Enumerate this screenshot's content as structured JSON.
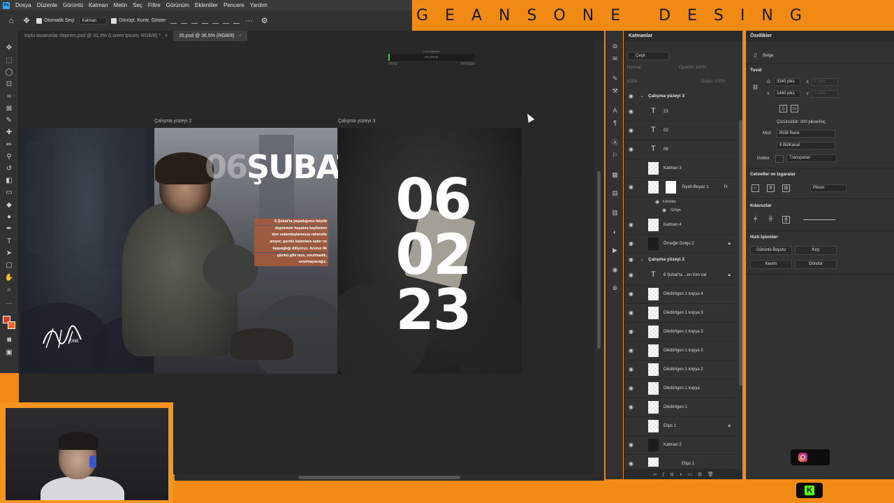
{
  "brand": {
    "text": "GEANSONE DESING"
  },
  "menu": [
    "Dosya",
    "Düzenle",
    "Görüntü",
    "Katman",
    "Metin",
    "Seç",
    "Filtre",
    "Görünüm",
    "Eklentiler",
    "Pencere",
    "Yardım"
  ],
  "options": {
    "auto_select": "Otomatik Seçi",
    "target": "Katman",
    "transform_controls": "Dönüşt. Kontr. Göster"
  },
  "tabs": [
    {
      "label": "toplu tasarımlar deprem.psd @ 31,3% (Lorem Ipsum, RGB/8) *",
      "active": false
    },
    {
      "label": "26.psd @ 36,6% (RGB/8)",
      "active": true
    }
  ],
  "widget": {
    "caption": "Yürü Bitkokun",
    "value_text": "%0 (TRY0)",
    "low": "TRY0",
    "high": "TRY5000",
    "progress": 0.0
  },
  "artboards": {
    "label_2": "Çalışma yüzeyi 2",
    "label_3": "Çalışma yüzeyi 3"
  },
  "poster": {
    "headline_ghost": "06",
    "headline": "ŞUBAT",
    "caption_lines": [
      "6 Şubat'ta yaşadığımız büyük",
      "depremde hayatını kaybeden",
      "tüm vatandaşlarımıza rahmetle",
      "anıyor, geride kalanlara sabır ve",
      "başsağlığı diliyoruz. Acımız ilk",
      "günkü gibi taze, unutmadık,",
      "unutmayacağız."
    ],
    "date_day": "06",
    "date_month": "02",
    "date_year": "23"
  },
  "layers": {
    "title": "Katmanlar",
    "filter": "Çeşit",
    "blend": "Normal",
    "opacity_label": "Opaklık: 100%",
    "lock_label": "Kilitle:",
    "fill_label": "Dolgu: 100%",
    "groups": [
      {
        "name": "Çalışma yüzeyi 3"
      },
      {
        "name": "Çalışma yüzeyi 2"
      }
    ],
    "rows": [
      {
        "name": "23",
        "kind": "text"
      },
      {
        "name": "02",
        "kind": "text"
      },
      {
        "name": "06",
        "kind": "text"
      },
      {
        "name": "Katman 3",
        "kind": "image"
      },
      {
        "name": "Siyah-Beyaz 1",
        "kind": "adjust",
        "fx": "fx"
      },
      {
        "name": "Katman 4",
        "kind": "image"
      },
      {
        "name": "Örneğin Dolgu 2",
        "kind": "dark",
        "locked": true
      },
      {
        "name": "6 Şubat'ta ...en tüm vat",
        "kind": "text",
        "locked": true
      },
      {
        "name": "Dikdörtgen 1 kopya 4",
        "kind": "shape"
      },
      {
        "name": "Dikdörtgen 1 kopya 3",
        "kind": "shape"
      },
      {
        "name": "Dikdörtgen 1 kopya 3",
        "kind": "shape"
      },
      {
        "name": "Dikdörtgen 1 kopya 3",
        "kind": "shape"
      },
      {
        "name": "Dikdörtgen 1 kopya 2",
        "kind": "shape"
      },
      {
        "name": "Dikdörtgen 1 kopya",
        "kind": "shape"
      },
      {
        "name": "Dikdörtgen 1",
        "kind": "shape"
      },
      {
        "name": "Elips 1",
        "kind": "shape",
        "locked": true
      },
      {
        "name": "Katman 2",
        "kind": "dark"
      },
      {
        "name": "Elips 1",
        "kind": "shape"
      }
    ],
    "effects": {
      "label": "Efektler",
      "shadow": "Gölge"
    }
  },
  "properties": {
    "title": "Özellikler",
    "doc_label": "Belge",
    "canvas_section": "Tuval",
    "width": "3240 piks",
    "height": "1440 piks",
    "x_placeholder": "0 piks",
    "y_placeholder": "0 piks",
    "w_label": "G",
    "h_label": "Y",
    "x_label": "X",
    "y_label": "Y",
    "resolution": "Çözünürlük: 300 piksel/inç",
    "mode_label": "Mod",
    "mode": "RGB Renk",
    "bits": "8 Bit/Kanal",
    "fill_label": "Doldur",
    "fill": "Transparan",
    "rulers_section": "Cetveller ve Izgaralar",
    "unit": "Piksel",
    "guides_section": "Kılavuzlar",
    "quick_section": "Hızlı İşlemler",
    "btn_image_size": "Görüntü Boyutu",
    "btn_crop": "Kırp",
    "btn_trim": "Kesim",
    "btn_rotate": "Döndür"
  }
}
